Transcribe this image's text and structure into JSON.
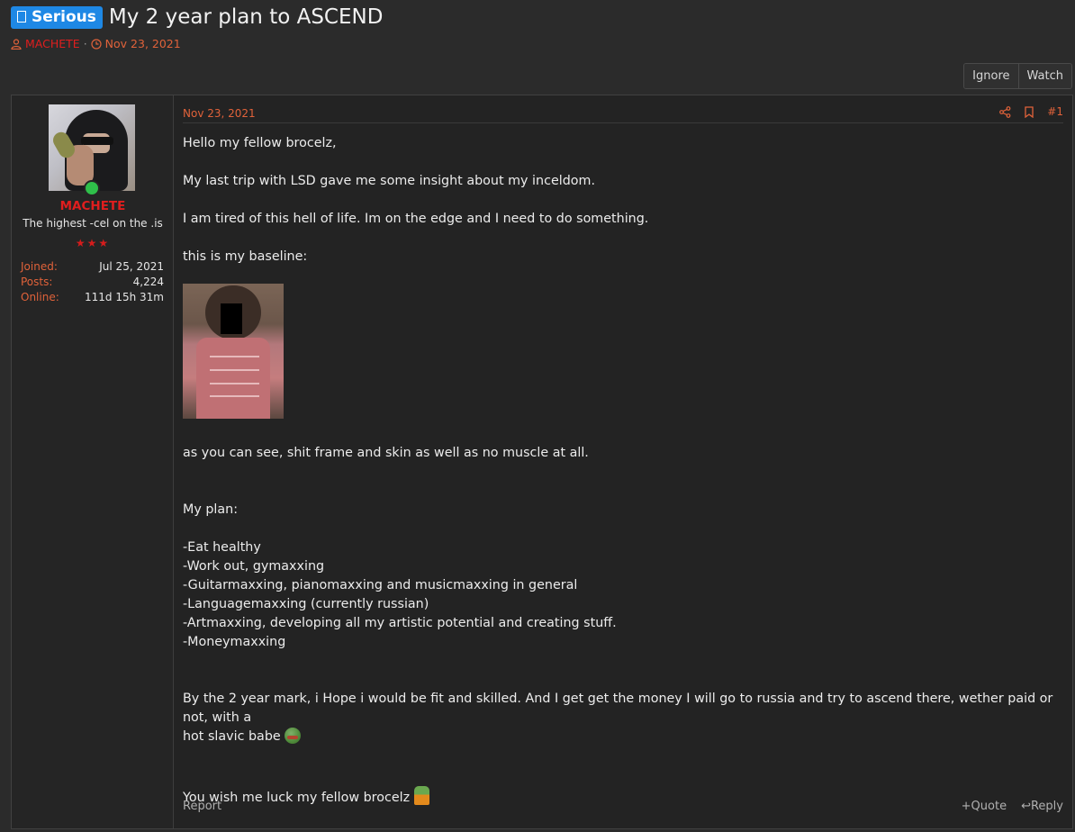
{
  "thread": {
    "prefix_icon": "info-icon",
    "prefix_label": "Serious",
    "title": "My 2 year plan to ASCEND",
    "author": "MACHETE",
    "separator": "·",
    "date": "Nov 23, 2021"
  },
  "thread_buttons": {
    "ignore": "Ignore",
    "watch": "Watch"
  },
  "colors": {
    "accent": "#e0623a",
    "username": "#e01e1e",
    "badge": "#1e88e5",
    "online": "#2fbf4a"
  },
  "user": {
    "name": "MACHETE",
    "title": "The highest -cel on the .is",
    "stars": "★★★",
    "stats": [
      {
        "label": "Joined:",
        "value": "Jul 25, 2021"
      },
      {
        "label": "Posts:",
        "value": "4,224"
      },
      {
        "label": "Online:",
        "value": "111d 15h 31m"
      }
    ]
  },
  "post": {
    "date": "Nov 23, 2021",
    "number": "#1",
    "paragraphs": {
      "p1": "Hello my fellow brocelz,",
      "p2": "My last trip with LSD gave me some insight about my inceldom.",
      "p3": "I am tired of this hell of life. Im on the edge and I need to do something.",
      "p4": "this is my baseline:",
      "p5": "as you can see, shit frame and skin as well as no muscle at all.",
      "p6": "My plan:",
      "plan": [
        "-Eat healthy",
        "-Work out, gymaxxing",
        "-Guitarmaxxing, pianomaxxing and musicmaxxing in general",
        "-Languagemaxxing (currently russian)",
        "-Artmaxxing, developing all my artistic potential and creating stuff.",
        "-Moneymaxxing"
      ],
      "p7a": "By the 2 year mark, i Hope i would be fit and skilled. And I get get the money I will go to russia and try to ascend there, wether paid or not, with a",
      "p7b": "hot slavic babe",
      "p8": "You wish me luck my fellow brocelz"
    },
    "footer": {
      "report": "Report",
      "quote": "Quote",
      "reply": "Reply"
    }
  }
}
